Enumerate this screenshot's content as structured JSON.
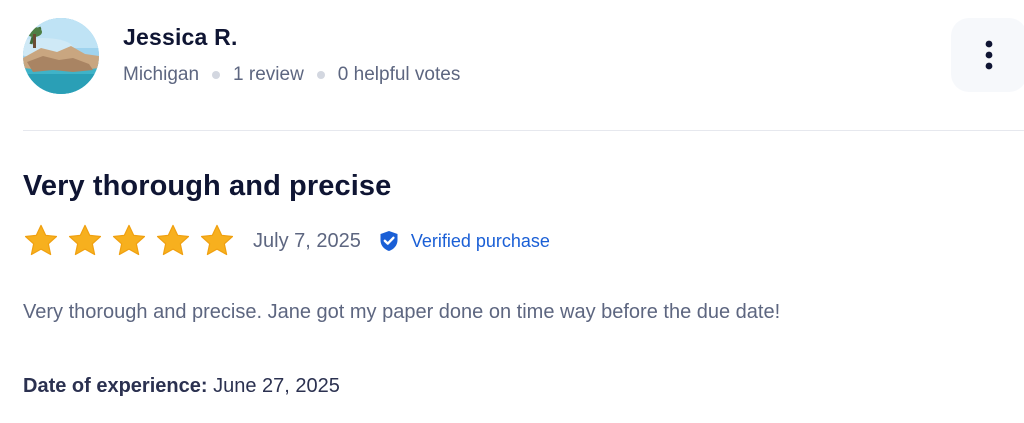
{
  "reviewer": {
    "name": "Jessica R.",
    "location": "Michigan",
    "review_count": "1 review",
    "helpful_votes": "0 helpful votes"
  },
  "review": {
    "title": "Very thorough and precise",
    "rating": 5,
    "rating_max": 5,
    "date": "July 7, 2025",
    "verified_label": "Verified purchase",
    "body": "Very thorough and precise. Jane got my paper done on time way before the due date!",
    "experience_label": "Date of experience:",
    "experience_date": "June 27, 2025"
  },
  "icons": {
    "more": "more-vertical-icon",
    "star": "star-icon",
    "verified": "shield-check-icon"
  },
  "colors": {
    "star": "#f7b01e",
    "verified": "#1a5fd6",
    "title": "#0f1533",
    "muted": "#5d6680"
  }
}
